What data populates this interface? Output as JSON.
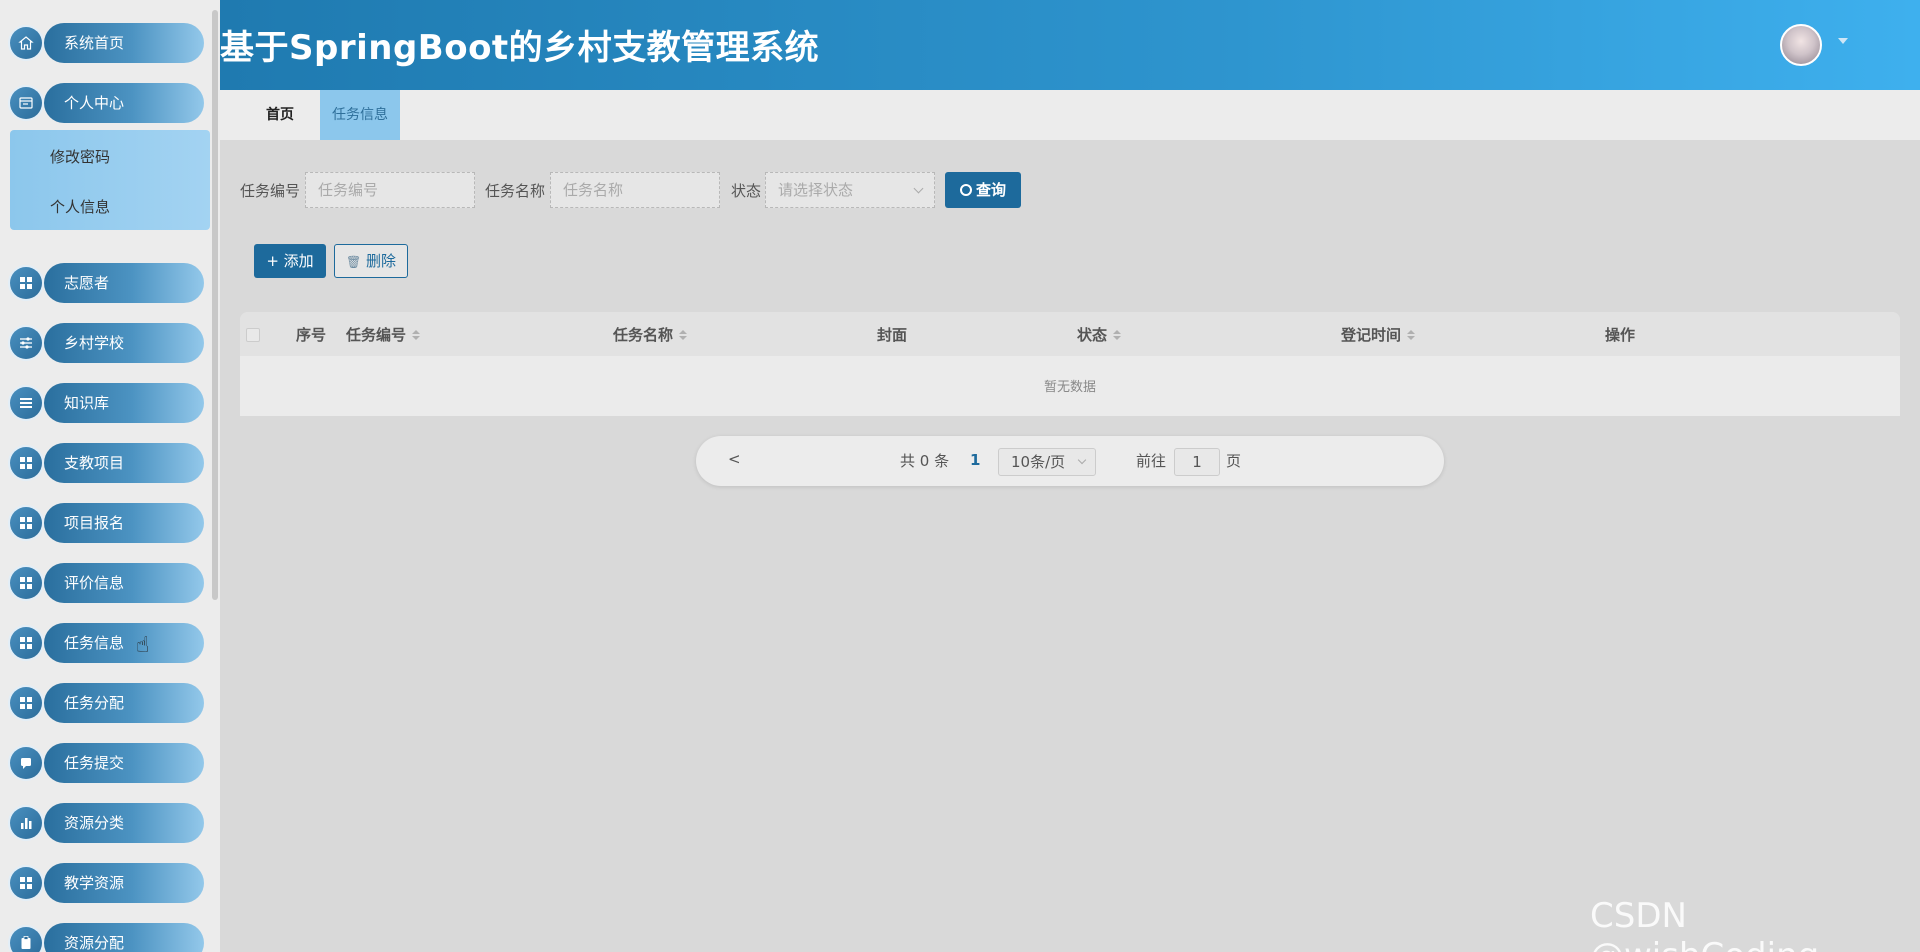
{
  "app": {
    "title": "基于SpringBoot的乡村支教管理系统"
  },
  "sidebar": {
    "items": [
      {
        "label": "系统首页",
        "icon": "home-icon"
      },
      {
        "label": "个人中心",
        "icon": "profile-icon"
      },
      {
        "label": "志愿者",
        "icon": "grid-icon"
      },
      {
        "label": "乡村学校",
        "icon": "sliders-icon"
      },
      {
        "label": "知识库",
        "icon": "list-icon"
      },
      {
        "label": "支教项目",
        "icon": "grid-icon"
      },
      {
        "label": "项目报名",
        "icon": "grid-icon"
      },
      {
        "label": "评价信息",
        "icon": "grid-icon"
      },
      {
        "label": "任务信息",
        "icon": "grid-icon"
      },
      {
        "label": "任务分配",
        "icon": "grid-icon"
      },
      {
        "label": "任务提交",
        "icon": "chat-icon"
      },
      {
        "label": "资源分类",
        "icon": "bar-chart-icon"
      },
      {
        "label": "教学资源",
        "icon": "grid-icon"
      },
      {
        "label": "资源分配",
        "icon": "clipboard-icon"
      }
    ],
    "submenu": [
      {
        "label": "修改密码"
      },
      {
        "label": "个人信息"
      }
    ]
  },
  "tabs": [
    {
      "label": "首页"
    },
    {
      "label": "任务信息"
    }
  ],
  "search": {
    "code_label": "任务编号",
    "code_placeholder": "任务编号",
    "name_label": "任务名称",
    "name_placeholder": "任务名称",
    "status_label": "状态",
    "status_placeholder": "请选择状态",
    "query_button": "查询"
  },
  "actions": {
    "add": "添加",
    "delete": "删除"
  },
  "table": {
    "columns": [
      "序号",
      "任务编号",
      "任务名称",
      "封面",
      "状态",
      "登记时间",
      "操作"
    ],
    "empty_text": "暂无数据"
  },
  "pagination": {
    "prev": "<",
    "total": "共 0 条",
    "current_page": "1",
    "page_size": "10条/页",
    "goto_label": "前往",
    "goto_value": "1",
    "goto_unit": "页"
  },
  "watermark": "CSDN @wishCoding",
  "colors": {
    "primary": "#1d6a9c",
    "header_start": "#1f7ab0",
    "header_end": "#3eb0ee",
    "active_tab": "#8cc7ec"
  }
}
